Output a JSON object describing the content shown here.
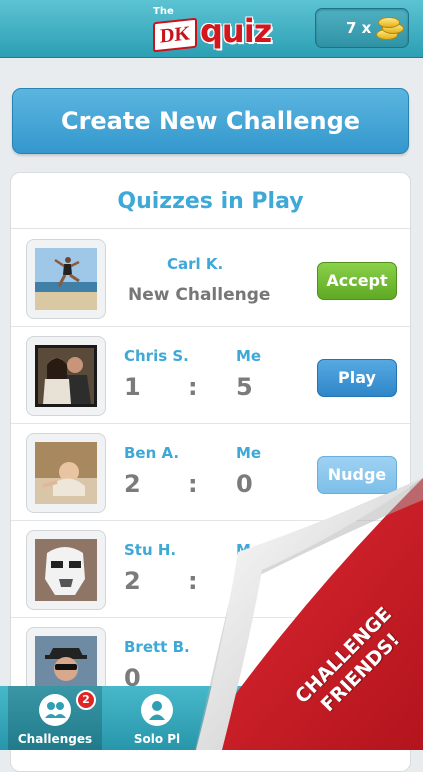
{
  "header": {
    "logo_the": "The",
    "logo_dk": "DK",
    "logo_quiz": "quiz",
    "coins_label": "7 x"
  },
  "create_button": "Create New Challenge",
  "panel_title": "Quizzes in Play",
  "rows": [
    {
      "name": "Carl K.",
      "subtitle": "New Challenge",
      "button": "Accept"
    },
    {
      "name": "Chris S.",
      "me": "Me",
      "their_score": "1",
      "sep": ":",
      "my_score": "5",
      "button": "Play"
    },
    {
      "name": "Ben A.",
      "me": "Me",
      "their_score": "2",
      "sep": ":",
      "my_score": "0",
      "button": "Nudge"
    },
    {
      "name": "Stu H.",
      "me": "Me",
      "their_score": "2",
      "sep": ":"
    },
    {
      "name": "Brett B.",
      "their_score": "0"
    }
  ],
  "tabs": [
    {
      "label": "Challenges",
      "badge": "2"
    },
    {
      "label": "Solo Pl"
    }
  ],
  "curl_text": "CHALLENGE FRIENDS!",
  "colors": {
    "header": "#2c9fb3",
    "accent_blue": "#3ea8d6",
    "accept_green": "#6bb82c",
    "curl_red": "#d61f2a"
  }
}
